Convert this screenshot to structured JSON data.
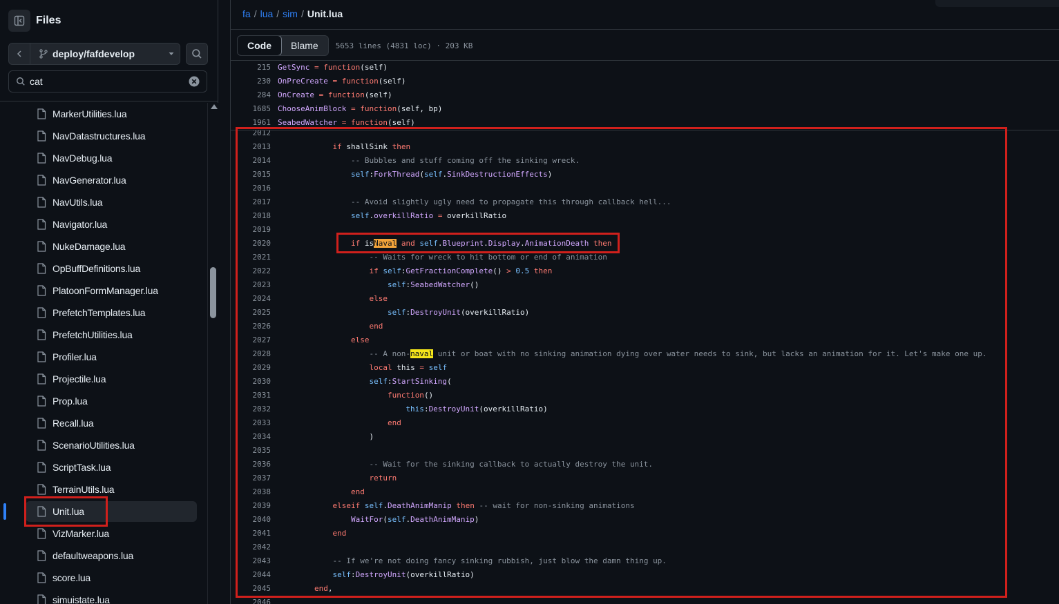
{
  "sidebar": {
    "title": "Files",
    "branch": "deploy/fafdevelop",
    "filter_value": "cat",
    "files": [
      "MarkerUtilities.lua",
      "NavDatastructures.lua",
      "NavDebug.lua",
      "NavGenerator.lua",
      "NavUtils.lua",
      "Navigator.lua",
      "NukeDamage.lua",
      "OpBuffDefinitions.lua",
      "PlatoonFormManager.lua",
      "PrefetchTemplates.lua",
      "PrefetchUtilities.lua",
      "Profiler.lua",
      "Projectile.lua",
      "Prop.lua",
      "Recall.lua",
      "ScenarioUtilities.lua",
      "ScriptTask.lua",
      "TerrainUtils.lua",
      "Unit.lua",
      "VizMarker.lua",
      "defaultweapons.lua",
      "score.lua",
      "simuistate.lua"
    ],
    "active_file": "Unit.lua"
  },
  "breadcrumb": {
    "repo": "fa",
    "dir1": "lua",
    "dir2": "sim",
    "file": "Unit.lua"
  },
  "toolbar": {
    "code_tab": "Code",
    "blame_tab": "Blame",
    "meta": "5653 lines (4831 loc) · 203 KB"
  },
  "sticky_lines": [
    {
      "n": "215",
      "t": [
        [
          "f",
          "GetSync"
        ],
        [
          "w",
          " "
        ],
        [
          "k",
          "="
        ],
        [
          "w",
          " "
        ],
        [
          "k",
          "function"
        ],
        [
          "w",
          "(self)"
        ]
      ]
    },
    {
      "n": "230",
      "t": [
        [
          "f",
          "OnPreCreate"
        ],
        [
          "w",
          " "
        ],
        [
          "k",
          "="
        ],
        [
          "w",
          " "
        ],
        [
          "k",
          "function"
        ],
        [
          "w",
          "(self)"
        ]
      ]
    },
    {
      "n": "284",
      "t": [
        [
          "f",
          "OnCreate"
        ],
        [
          "w",
          " "
        ],
        [
          "k",
          "="
        ],
        [
          "w",
          " "
        ],
        [
          "k",
          "function"
        ],
        [
          "w",
          "(self)"
        ]
      ]
    },
    {
      "n": "1685",
      "t": [
        [
          "f",
          "ChooseAnimBlock"
        ],
        [
          "w",
          " "
        ],
        [
          "k",
          "="
        ],
        [
          "w",
          " "
        ],
        [
          "k",
          "function"
        ],
        [
          "w",
          "(self, bp)"
        ]
      ]
    },
    {
      "n": "1961",
      "t": [
        [
          "f",
          "SeabedWatcher"
        ],
        [
          "w",
          " "
        ],
        [
          "k",
          "="
        ],
        [
          "w",
          " "
        ],
        [
          "k",
          "function"
        ],
        [
          "w",
          "(self)"
        ]
      ]
    }
  ],
  "code_lines": [
    {
      "n": "2012",
      "t": []
    },
    {
      "n": "2013",
      "t": [
        [
          "w",
          "            "
        ],
        [
          "k",
          "if"
        ],
        [
          "w",
          " shallSink "
        ],
        [
          "k",
          "then"
        ]
      ]
    },
    {
      "n": "2014",
      "t": [
        [
          "w",
          "                "
        ],
        [
          "c",
          "-- Bubbles and stuff coming off the sinking wreck."
        ]
      ]
    },
    {
      "n": "2015",
      "t": [
        [
          "w",
          "                "
        ],
        [
          "s",
          "self"
        ],
        [
          "w",
          ":"
        ],
        [
          "f",
          "ForkThread"
        ],
        [
          "w",
          "("
        ],
        [
          "s",
          "self"
        ],
        [
          "w",
          "."
        ],
        [
          "f",
          "SinkDestructionEffects"
        ],
        [
          "w",
          ")"
        ]
      ]
    },
    {
      "n": "2016",
      "t": []
    },
    {
      "n": "2017",
      "t": [
        [
          "w",
          "                "
        ],
        [
          "c",
          "-- Avoid slightly ugly need to propagate this through callback hell..."
        ]
      ]
    },
    {
      "n": "2018",
      "t": [
        [
          "w",
          "                "
        ],
        [
          "s",
          "self"
        ],
        [
          "w",
          "."
        ],
        [
          "f",
          "overkillRatio"
        ],
        [
          "w",
          " "
        ],
        [
          "k",
          "="
        ],
        [
          "w",
          " overkillRatio"
        ]
      ]
    },
    {
      "n": "2019",
      "t": []
    },
    {
      "n": "2020",
      "t": [
        [
          "w",
          "                "
        ],
        [
          "k",
          "if"
        ],
        [
          "w",
          " is"
        ],
        [
          "hlc",
          "Naval"
        ],
        [
          "w",
          " "
        ],
        [
          "k",
          "and"
        ],
        [
          "w",
          " "
        ],
        [
          "s",
          "self"
        ],
        [
          "w",
          "."
        ],
        [
          "f",
          "Blueprint"
        ],
        [
          "w",
          "."
        ],
        [
          "f",
          "Display"
        ],
        [
          "w",
          "."
        ],
        [
          "f",
          "AnimationDeath"
        ],
        [
          "w",
          " "
        ],
        [
          "k",
          "then"
        ]
      ]
    },
    {
      "n": "2021",
      "t": [
        [
          "w",
          "                    "
        ],
        [
          "c",
          "-- Waits for wreck to hit bottom or end of animation"
        ]
      ]
    },
    {
      "n": "2022",
      "t": [
        [
          "w",
          "                    "
        ],
        [
          "k",
          "if"
        ],
        [
          "w",
          " "
        ],
        [
          "s",
          "self"
        ],
        [
          "w",
          ":"
        ],
        [
          "f",
          "GetFractionComplete"
        ],
        [
          "w",
          "() "
        ],
        [
          "k",
          ">"
        ],
        [
          "w",
          " "
        ],
        [
          "n",
          "0.5"
        ],
        [
          "w",
          " "
        ],
        [
          "k",
          "then"
        ]
      ]
    },
    {
      "n": "2023",
      "t": [
        [
          "w",
          "                        "
        ],
        [
          "s",
          "self"
        ],
        [
          "w",
          ":"
        ],
        [
          "f",
          "SeabedWatcher"
        ],
        [
          "w",
          "()"
        ]
      ]
    },
    {
      "n": "2024",
      "t": [
        [
          "w",
          "                    "
        ],
        [
          "k",
          "else"
        ]
      ]
    },
    {
      "n": "2025",
      "t": [
        [
          "w",
          "                        "
        ],
        [
          "s",
          "self"
        ],
        [
          "w",
          ":"
        ],
        [
          "f",
          "DestroyUnit"
        ],
        [
          "w",
          "(overkillRatio)"
        ]
      ]
    },
    {
      "n": "2026",
      "t": [
        [
          "w",
          "                    "
        ],
        [
          "k",
          "end"
        ]
      ]
    },
    {
      "n": "2027",
      "t": [
        [
          "w",
          "                "
        ],
        [
          "k",
          "else"
        ]
      ]
    },
    {
      "n": "2028",
      "t": [
        [
          "w",
          "                    "
        ],
        [
          "c",
          "-- A non-"
        ],
        [
          "hl",
          "naval"
        ],
        [
          "c",
          " unit or boat with no sinking animation dying over water needs to sink, but lacks an animation for it. Let's make one up."
        ]
      ]
    },
    {
      "n": "2029",
      "t": [
        [
          "w",
          "                    "
        ],
        [
          "k",
          "local"
        ],
        [
          "w",
          " this "
        ],
        [
          "k",
          "="
        ],
        [
          "w",
          " "
        ],
        [
          "s",
          "self"
        ]
      ]
    },
    {
      "n": "2030",
      "t": [
        [
          "w",
          "                    "
        ],
        [
          "s",
          "self"
        ],
        [
          "w",
          ":"
        ],
        [
          "f",
          "StartSinking"
        ],
        [
          "w",
          "("
        ]
      ]
    },
    {
      "n": "2031",
      "t": [
        [
          "w",
          "                        "
        ],
        [
          "k",
          "function"
        ],
        [
          "w",
          "()"
        ]
      ]
    },
    {
      "n": "2032",
      "t": [
        [
          "w",
          "                            "
        ],
        [
          "s",
          "this"
        ],
        [
          "w",
          ":"
        ],
        [
          "f",
          "DestroyUnit"
        ],
        [
          "w",
          "(overkillRatio)"
        ]
      ]
    },
    {
      "n": "2033",
      "t": [
        [
          "w",
          "                        "
        ],
        [
          "k",
          "end"
        ]
      ]
    },
    {
      "n": "2034",
      "t": [
        [
          "w",
          "                    )"
        ]
      ]
    },
    {
      "n": "2035",
      "t": []
    },
    {
      "n": "2036",
      "t": [
        [
          "w",
          "                    "
        ],
        [
          "c",
          "-- Wait for the sinking callback to actually destroy the unit."
        ]
      ]
    },
    {
      "n": "2037",
      "t": [
        [
          "w",
          "                    "
        ],
        [
          "k",
          "return"
        ]
      ]
    },
    {
      "n": "2038",
      "t": [
        [
          "w",
          "                "
        ],
        [
          "k",
          "end"
        ]
      ]
    },
    {
      "n": "2039",
      "t": [
        [
          "w",
          "            "
        ],
        [
          "k",
          "elseif"
        ],
        [
          "w",
          " "
        ],
        [
          "s",
          "self"
        ],
        [
          "w",
          "."
        ],
        [
          "f",
          "DeathAnimManip"
        ],
        [
          "w",
          " "
        ],
        [
          "k",
          "then"
        ],
        [
          "w",
          " "
        ],
        [
          "c",
          "-- wait for non-sinking animations"
        ]
      ]
    },
    {
      "n": "2040",
      "t": [
        [
          "w",
          "                "
        ],
        [
          "f",
          "WaitFor"
        ],
        [
          "w",
          "("
        ],
        [
          "s",
          "self"
        ],
        [
          "w",
          "."
        ],
        [
          "f",
          "DeathAnimManip"
        ],
        [
          "w",
          ")"
        ]
      ]
    },
    {
      "n": "2041",
      "t": [
        [
          "w",
          "            "
        ],
        [
          "k",
          "end"
        ]
      ]
    },
    {
      "n": "2042",
      "t": []
    },
    {
      "n": "2043",
      "t": [
        [
          "w",
          "            "
        ],
        [
          "c",
          "-- If we're not doing fancy sinking rubbish, just blow the damn thing up."
        ]
      ]
    },
    {
      "n": "2044",
      "t": [
        [
          "w",
          "            "
        ],
        [
          "s",
          "self"
        ],
        [
          "w",
          ":"
        ],
        [
          "f",
          "DestroyUnit"
        ],
        [
          "w",
          "(overkillRatio)"
        ]
      ]
    },
    {
      "n": "2045",
      "t": [
        [
          "w",
          "        "
        ],
        [
          "k",
          "end"
        ],
        [
          "w",
          ","
        ]
      ]
    },
    {
      "n": "2046",
      "t": []
    }
  ],
  "colors": {
    "highlight_box": "#d0201c",
    "search_match": "#f5e61b",
    "current_match": "#f2a33a",
    "accent": "#2f81f7"
  }
}
